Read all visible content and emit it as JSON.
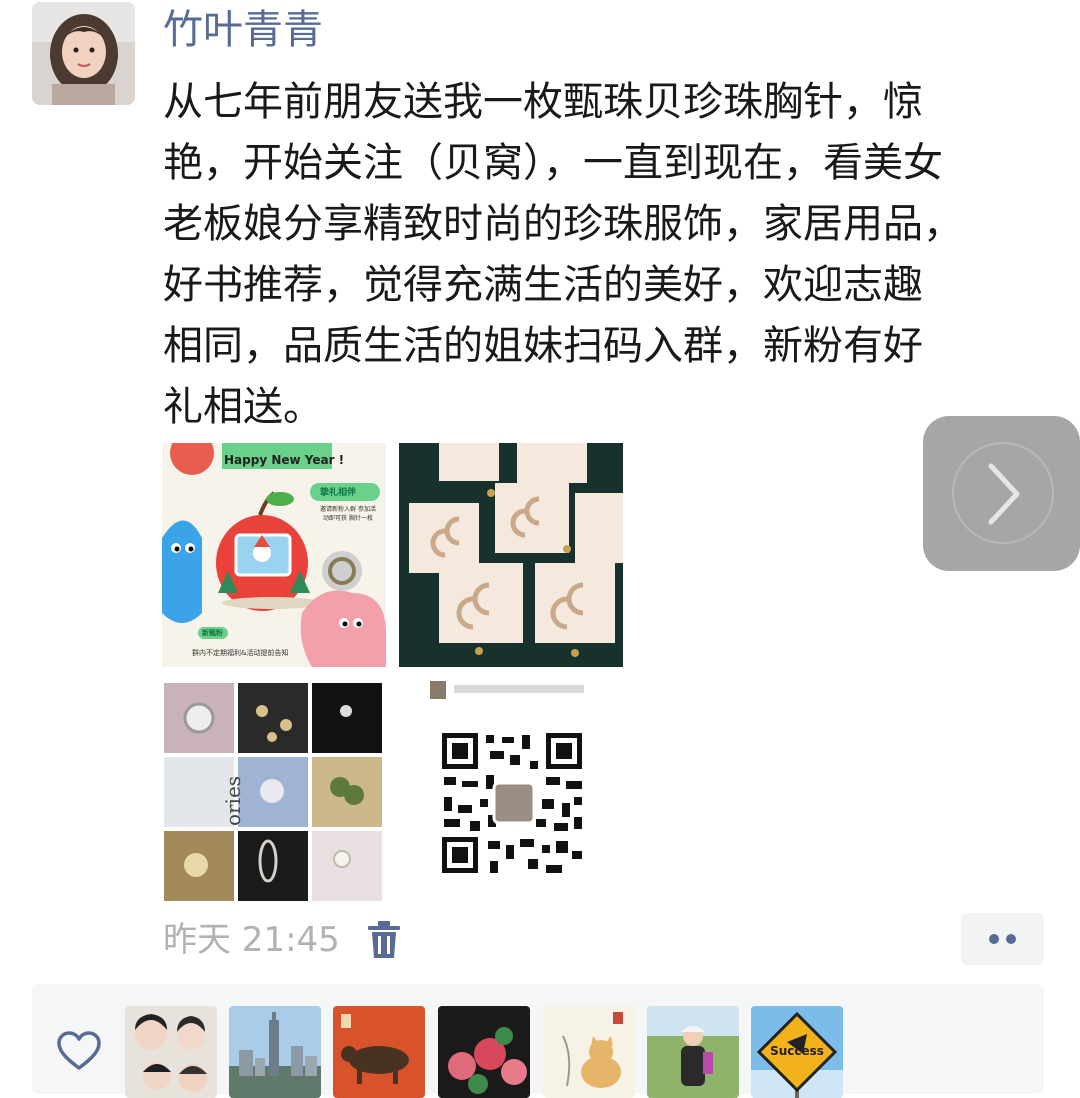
{
  "post": {
    "author": "竹叶青青",
    "text_lines": [
      "从七年前朋友送我一枚甄珠贝珍珠胸针，惊",
      "艳，开始关注（贝窝），一直到现在，看美女",
      "老板娘分享精致时尚的珍珠服饰，家居用品，",
      "好书推荐，觉得充满生活的美好，欢迎志趣",
      "相同，品质生活的姐妹扫码入群，新粉有好",
      "礼相送。"
    ],
    "timestamp": "昨天 21:45"
  },
  "images": {
    "poster_headline": "Happy New Year !",
    "poster_tag_gift": "挚礼相伴",
    "poster_gift_desc": "邀请新粉入群 参加活动即可获 胸针一枚",
    "poster_tag_new": "新甄粉",
    "poster_footer": "群内不定期福利&活动提前告知",
    "collage_text": "ories"
  },
  "likes": {
    "avatars": [
      "friend-photo-1",
      "city-skyline",
      "ox-painting",
      "red-flowers",
      "cat-sketch",
      "hiker-photo",
      "success-sign"
    ],
    "success_sign_text": "Success"
  },
  "colors": {
    "name_link": "#576b95",
    "body_text": "#191919",
    "timestamp": "#b2b2b2",
    "panel_bg": "#f5f6f8"
  }
}
